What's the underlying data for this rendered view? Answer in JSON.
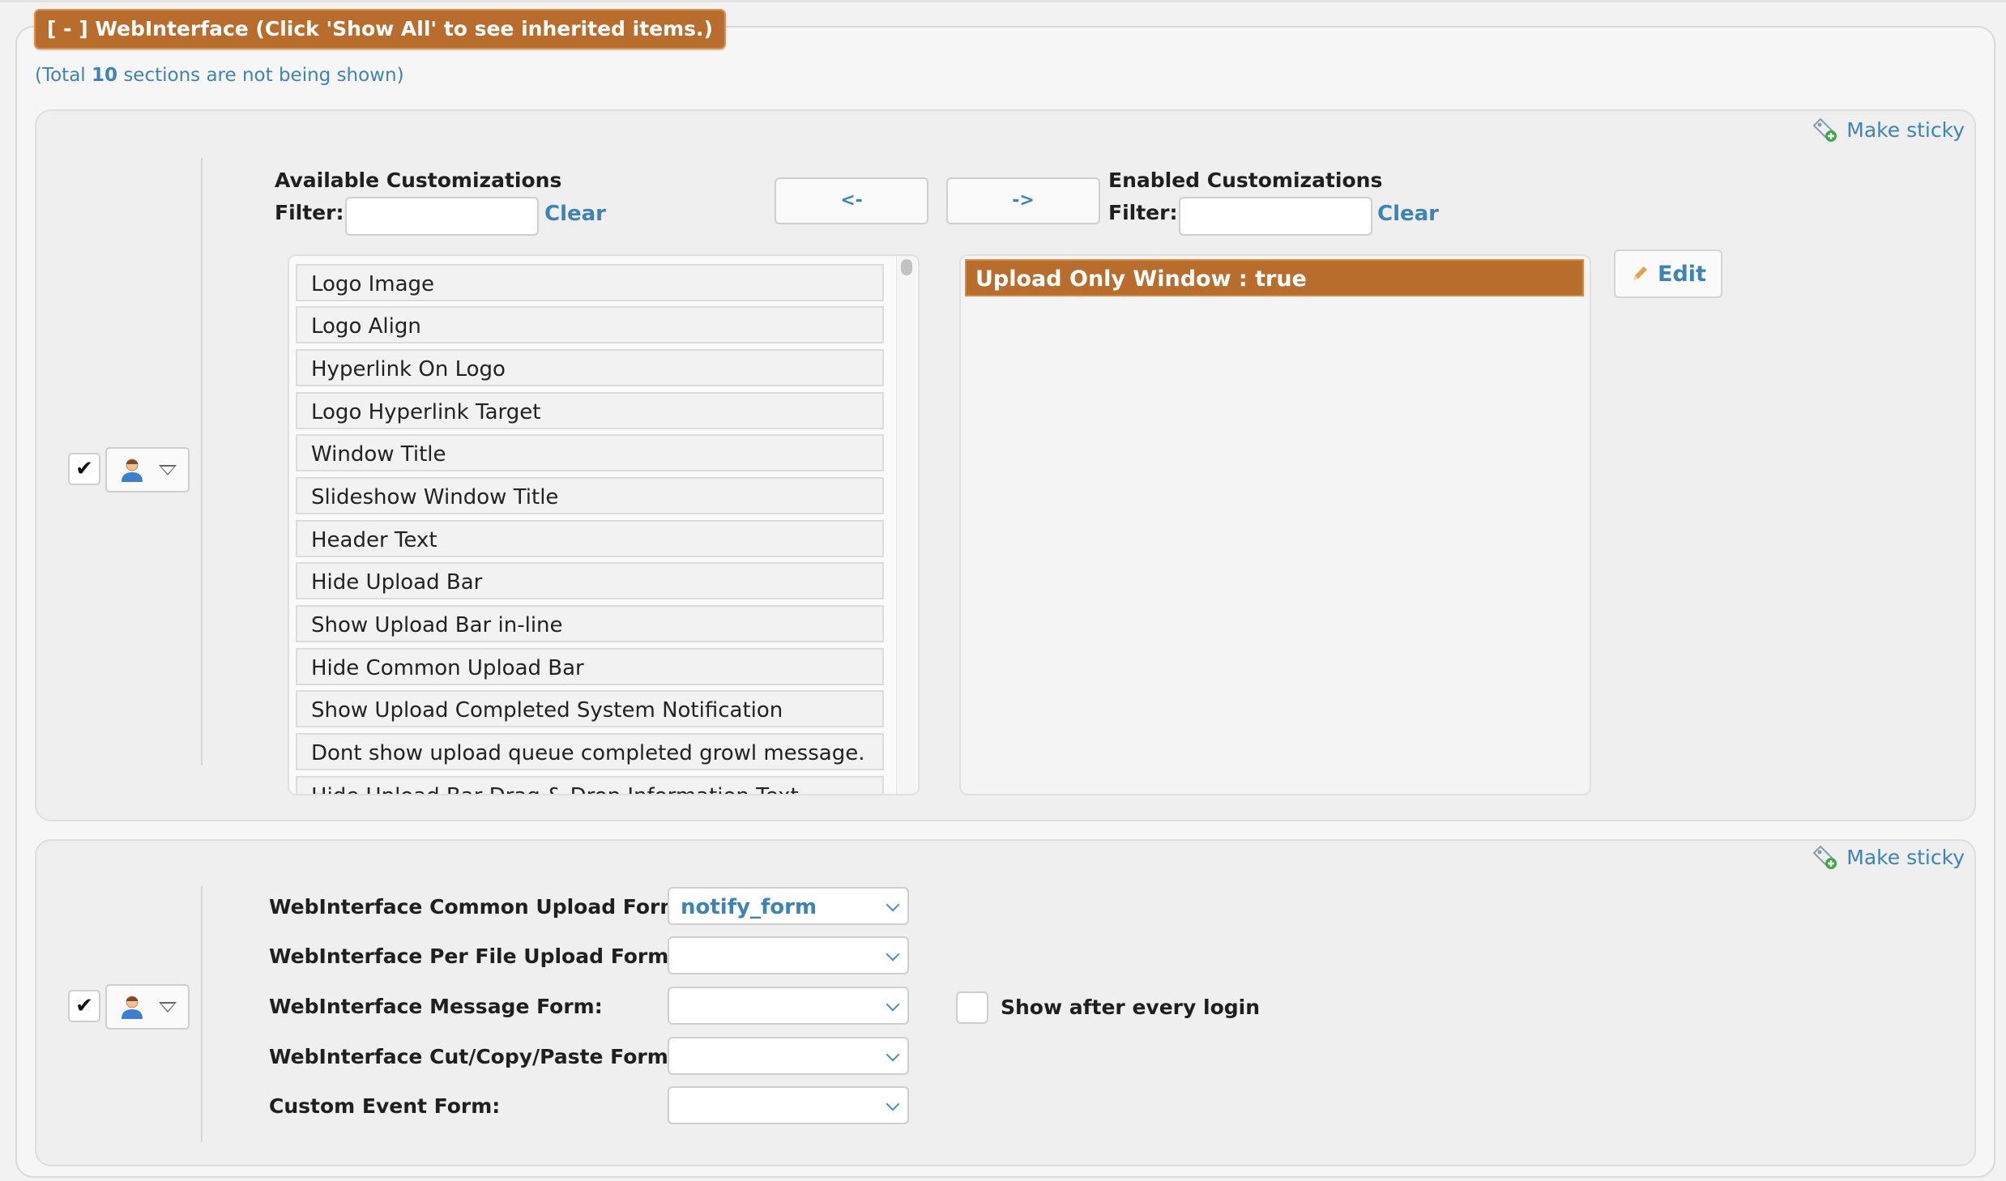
{
  "section_title": "[ - ] WebInterface (Click 'Show All' to see inherited items.)",
  "total_note": {
    "before": "(Total ",
    "count": "10",
    "after": " sections are not being shown)"
  },
  "sticky_label": "Make sticky",
  "customizations": {
    "available_heading": "Available Customizations",
    "enabled_heading": "Enabled Customizations",
    "filter_label": "Filter:",
    "clear_label": "Clear",
    "move_left_label": "<-",
    "move_right_label": "->",
    "edit_label": "Edit",
    "available_items": [
      "Logo Image",
      "Logo Align",
      "Hyperlink On Logo",
      "Logo Hyperlink Target",
      "Window Title",
      "Slideshow Window Title",
      "Header Text",
      "Hide Upload Bar",
      "Show Upload Bar in-line",
      "Hide Common Upload Bar",
      "Show Upload Completed System Notification",
      "Dont show upload queue completed growl message.",
      "Hide Upload Bar Drag & Drop Information Text"
    ],
    "enabled_items": [
      "Upload Only Window : true"
    ]
  },
  "forms": {
    "common_upload_label": "WebInterface Common Upload Form:",
    "common_upload_value": "notify_form",
    "per_file_label": "WebInterface Per File Upload Form:",
    "per_file_value": "",
    "message_label": "WebInterface Message Form:",
    "message_value": "",
    "cut_copy_paste_label": "WebInterface Cut/Copy/Paste Form:",
    "cut_copy_paste_value": "",
    "custom_event_label": "Custom Event Form:",
    "custom_event_value": "",
    "show_after_login_label": "Show after every login"
  },
  "colors": {
    "accent": "#b96d2c",
    "link": "#3d84b5"
  },
  "icons": {
    "checkmark": "checkmark-icon",
    "user": "user-icon",
    "dropdown": "dropdown-triangle-icon",
    "sticky": "sticky-tag-icon",
    "edit": "pencil-icon"
  }
}
